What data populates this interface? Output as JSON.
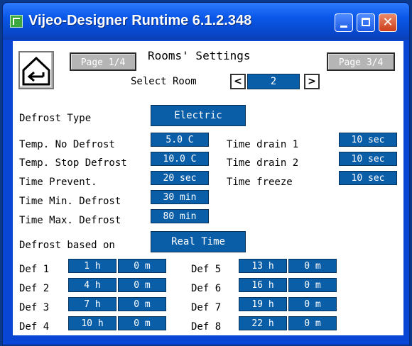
{
  "window": {
    "title": "Vijeo-Designer Runtime 6.1.2.348",
    "close_glyph": "✕"
  },
  "header": {
    "page_prev": "Page 1/4",
    "title": "Rooms' Settings",
    "page_next": "Page 3/4",
    "select_room_label": "Select Room",
    "room_value": "2",
    "prev_arrow": "<",
    "next_arrow": ">"
  },
  "defrost_type": {
    "label": "Defrost Type",
    "value": "Electric"
  },
  "params_left": [
    {
      "label": "Temp. No Defrost",
      "value": "5.0 C"
    },
    {
      "label": "Temp. Stop Defrost",
      "value": "10.0 C"
    },
    {
      "label": "Time Prevent.",
      "value": "20 sec"
    },
    {
      "label": "Time Min. Defrost",
      "value": "30 min"
    },
    {
      "label": "Time Max. Defrost",
      "value": "80 min"
    }
  ],
  "params_right": [
    {
      "label": "Time drain 1",
      "value": "10 sec"
    },
    {
      "label": "Time drain 2",
      "value": "10 sec"
    },
    {
      "label": "Time freeze",
      "value": "10 sec"
    }
  ],
  "defrost_based": {
    "label": "Defrost based on",
    "value": "Real Time"
  },
  "defrost_schedule": [
    {
      "label": "Def 1",
      "hour": "1 h",
      "min": "0 m"
    },
    {
      "label": "Def 2",
      "hour": "4 h",
      "min": "0 m"
    },
    {
      "label": "Def 3",
      "hour": "7 h",
      "min": "0 m"
    },
    {
      "label": "Def 4",
      "hour": "10 h",
      "min": "0 m"
    },
    {
      "label": "Def 5",
      "hour": "13 h",
      "min": "0 m"
    },
    {
      "label": "Def 6",
      "hour": "16 h",
      "min": "0 m"
    },
    {
      "label": "Def 7",
      "hour": "19 h",
      "min": "0 m"
    },
    {
      "label": "Def 8",
      "hour": "22 h",
      "min": "0 m"
    }
  ],
  "icons": {
    "app": "app-icon",
    "home": "back-home-icon"
  },
  "colors": {
    "titlebar": "#0a57e8",
    "value_field": "#0a5ea8",
    "page_button": "#b5b5b5"
  }
}
